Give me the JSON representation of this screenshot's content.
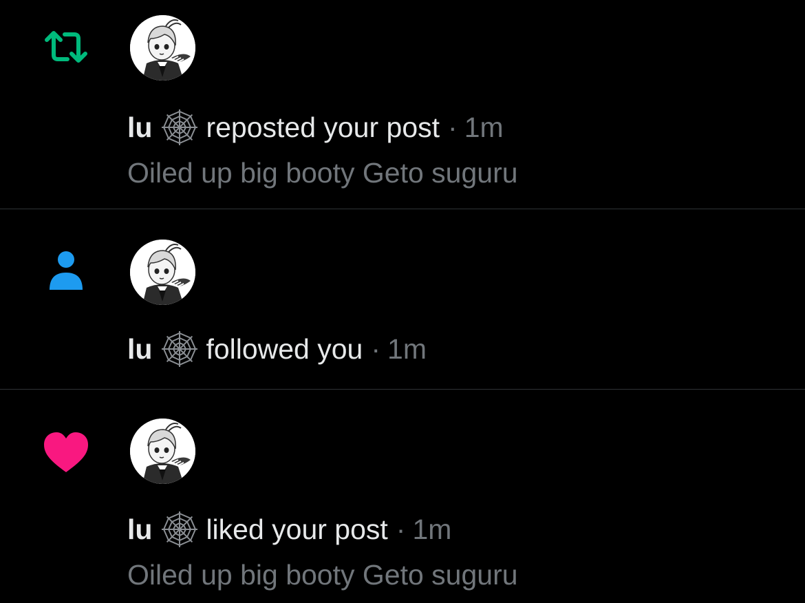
{
  "notifications": [
    {
      "type_icon": "repost-icon",
      "icon_color": "#00ba7c",
      "user_name": "lu",
      "badge_icon": "spiderweb-icon",
      "action": "reposted your post",
      "separator": "·",
      "time": "1m",
      "post_text": "Oiled up big booty Geto suguru"
    },
    {
      "type_icon": "person-follow-icon",
      "icon_color": "#1d9bf0",
      "user_name": "lu",
      "badge_icon": "spiderweb-icon",
      "action": "followed you",
      "separator": "·",
      "time": "1m"
    },
    {
      "type_icon": "heart-icon",
      "icon_color": "#f91880",
      "user_name": "lu",
      "badge_icon": "spiderweb-icon",
      "action": "liked your post",
      "separator": "·",
      "time": "1m",
      "post_text": "Oiled up big booty Geto suguru"
    }
  ]
}
